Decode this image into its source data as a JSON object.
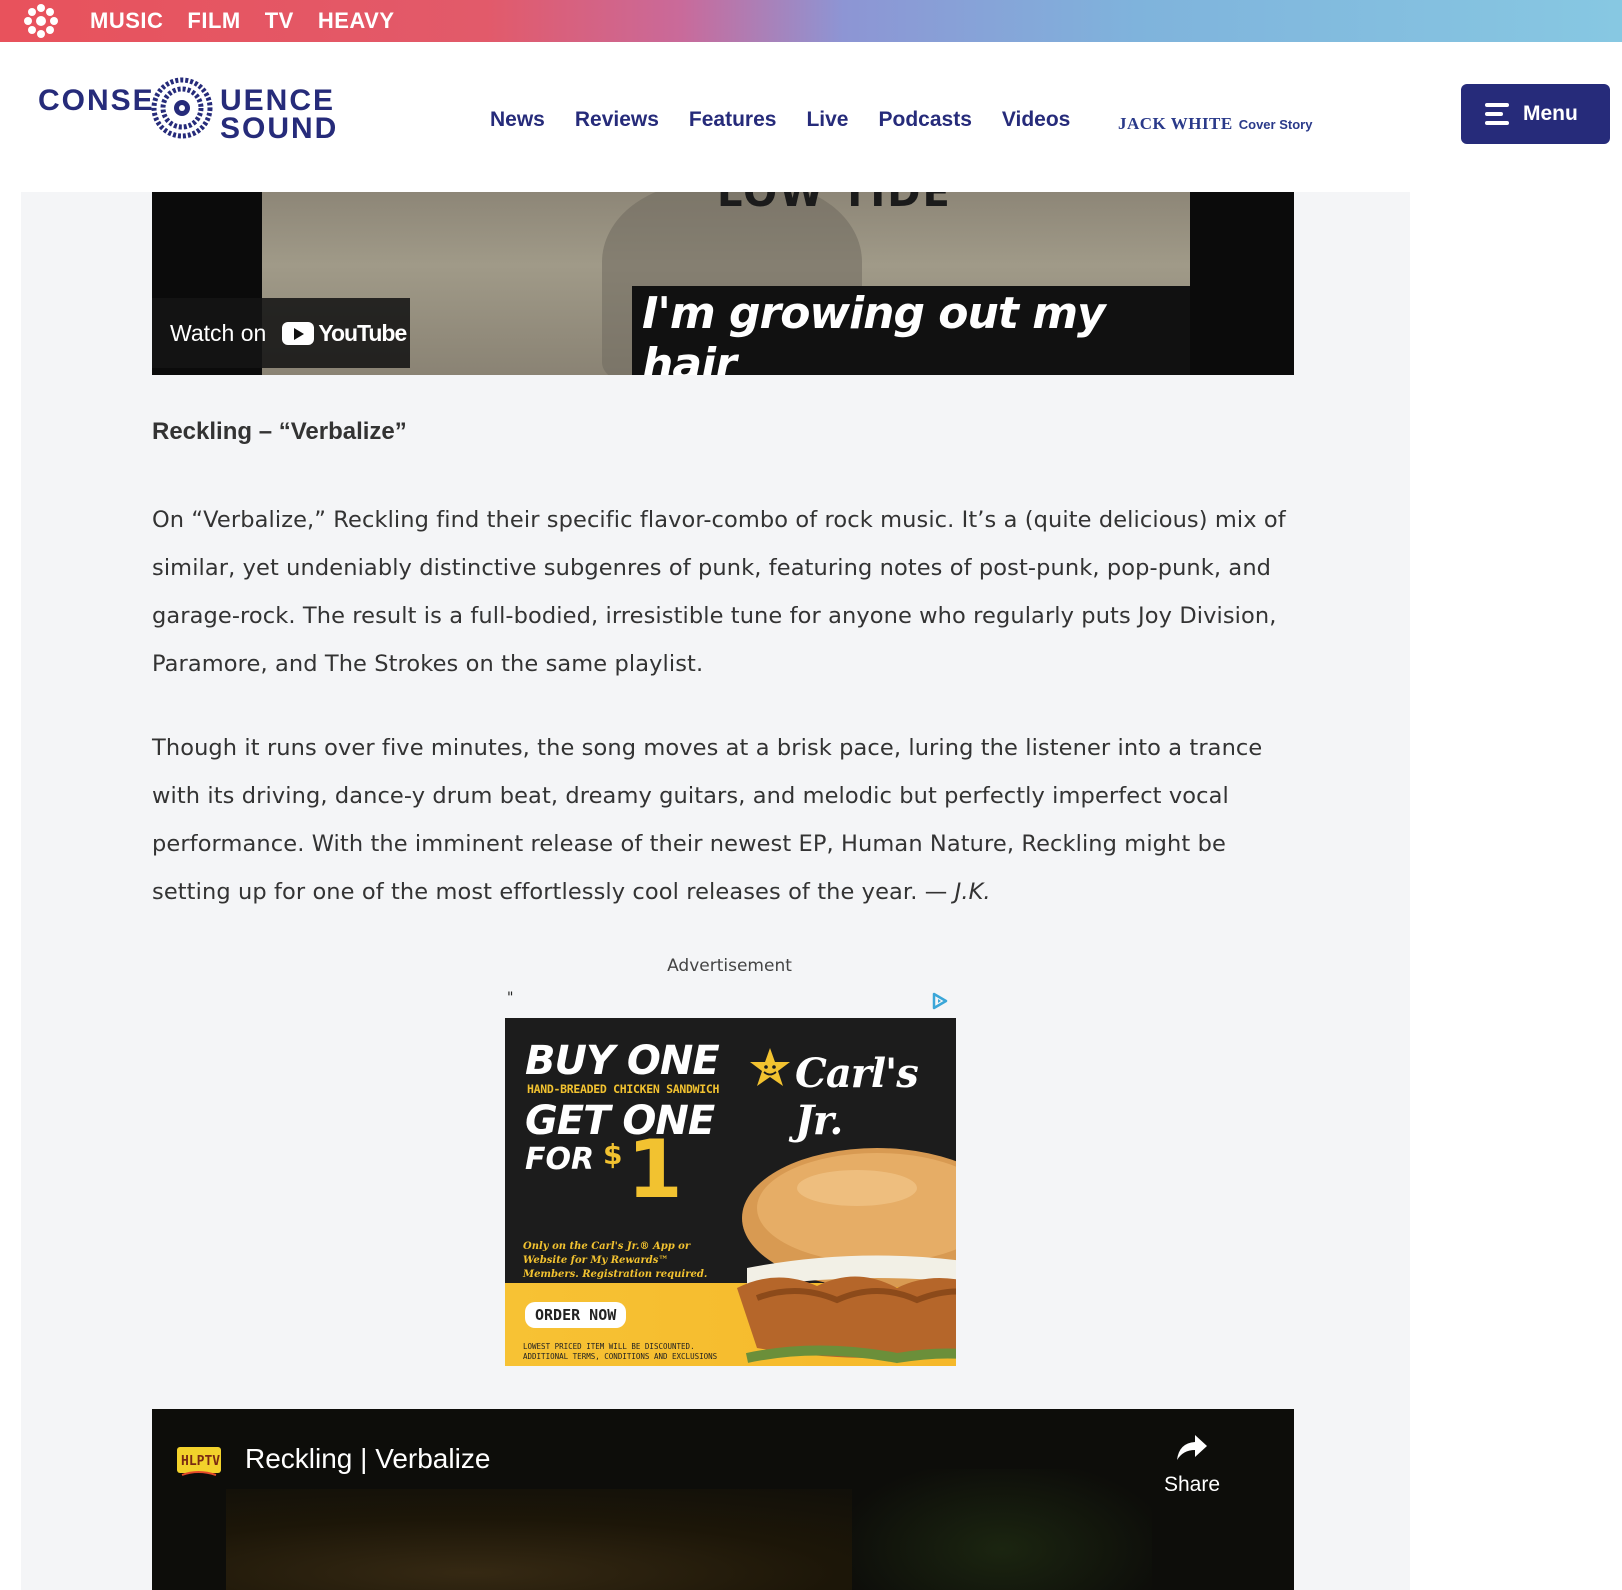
{
  "network_bar": {
    "links": [
      "MUSIC",
      "FILM",
      "TV",
      "HEAVY"
    ],
    "gradient_start": "#e8525c",
    "gradient_end": "#87c8e2"
  },
  "header": {
    "logo": {
      "word1": "CONSE",
      "word2": "UENCE",
      "word3": "SOUND"
    },
    "nav": [
      "News",
      "Reviews",
      "Features",
      "Live",
      "Podcasts",
      "Videos"
    ],
    "promo": {
      "name": "JACK WHITE",
      "tag": "Cover Story"
    },
    "menu_label": "Menu",
    "brand_color": "#262b7a"
  },
  "video1": {
    "overlay_text": "LOW TIDE",
    "caption": "I'm growing out my hair",
    "watch_on_label": "Watch on",
    "youtube_label": "YouTube"
  },
  "article": {
    "subhead": "Reckling – “Verbalize”",
    "p1": "On “Verbalize,” Reckling find their specific flavor-combo of rock music. It’s a (quite delicious) mix of similar, yet undeniably distinctive subgenres of punk, featuring notes of post-punk, pop-punk, and garage-rock. The result is a full-bodied, irresistible tune for anyone who regularly puts Joy Division, Paramore, and The Strokes on the same playlist.",
    "p2": "Though it runs over five minutes, the song moves at a brisk pace, luring the listener into a trance with its driving, dance-y drum beat, dreamy guitars, and melodic but perfectly imperfect vocal performance. With the imminent release of their newest EP, Human Nature, Reckling might be setting up for one of the most effortlessly cool releases of the year. —",
    "p2_author": "J.K."
  },
  "advertisement": {
    "label": "Advertisement",
    "quote_mark": "\"",
    "buy_one": "BUY ONE",
    "hand_breaded": "HAND-BREADED CHICKEN SANDWICH",
    "get_one": "GET ONE",
    "for": "FOR",
    "dollar": "$",
    "price": "1",
    "brand": "Carl's Jr.",
    "fine_print": "Only on the Carl's Jr.® App or Website for My Rewards™ Members. Registration required.",
    "order_button": "ORDER NOW",
    "legal": "LOWEST PRICED ITEM WILL BE DISCOUNTED. ADDITIONAL TERMS, CONDITIONS AND EXCLUSIONS"
  },
  "video2": {
    "channel_logo_text": "HLPTV",
    "title": "Reckling | Verbalize",
    "share_label": "Share"
  }
}
